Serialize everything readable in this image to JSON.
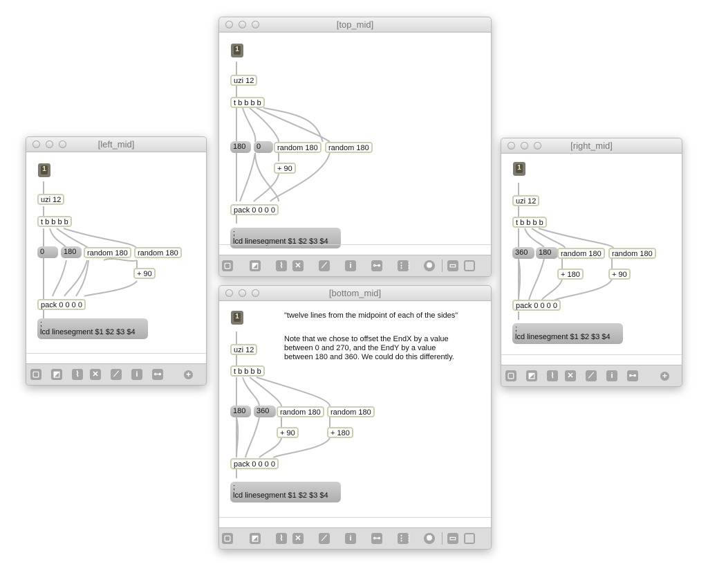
{
  "left_mid": {
    "title": "[left_mid]",
    "bang_label": "1",
    "uzi": "uzi 12",
    "trigger": "t b b b b",
    "msg1": "0",
    "msg2": "180",
    "random1": "random 180",
    "random2": "random 180",
    "plus1": "+ 90",
    "pack": "pack 0 0 0 0",
    "lcd": ";\nlcd linesegment $1 $2 $3 $4"
  },
  "top_mid": {
    "title": "[top_mid]",
    "bang_label": "1",
    "uzi": "uzi 12",
    "trigger": "t b b b b",
    "msg1": "180",
    "msg2": "0",
    "random1": "random 180",
    "random2": "random 180",
    "plus1": "+ 90",
    "pack": "pack 0 0 0 0",
    "lcd": ";\nlcd linesegment $1 $2 $3 $4"
  },
  "right_mid": {
    "title": "[right_mid]",
    "bang_label": "1",
    "uzi": "uzi 12",
    "trigger": "t b b b b",
    "msg1": "360",
    "msg2": "180",
    "random1": "random 180",
    "random2": "random 180",
    "plus1": "+ 180",
    "plus2": "+ 90",
    "pack": "pack 0 0 0 0",
    "lcd": ";\nlcd linesegment $1 $2 $3 $4"
  },
  "bottom_mid": {
    "title": "[bottom_mid]",
    "bang_label": "1",
    "uzi": "uzi 12",
    "trigger": "t b b b b",
    "msg1": "180",
    "msg2": "360",
    "random1": "random 180",
    "random2": "random 180",
    "plus1": "+ 90",
    "plus2": "+ 180",
    "pack": "pack 0 0 0 0",
    "lcd": ";\nlcd linesegment $1 $2 $3 $4",
    "comment1": "\"twelve lines from the midpoint of each of the sides\"",
    "comment2": "Note that we chose to offset the EndX by a value\nbetween 0 and 270, and the EndY by a value\nbetween 180 and 360. We could do this differently."
  },
  "toolbar_icons": [
    "lock-icon",
    "presentation-icon",
    "patchcord-icon",
    "clear-icon",
    "edit-icon",
    "info-icon",
    "inspector-icon",
    "grid-icon",
    "palette-icon",
    "split-view-icon",
    "sidebar-icon",
    "add-icon"
  ]
}
